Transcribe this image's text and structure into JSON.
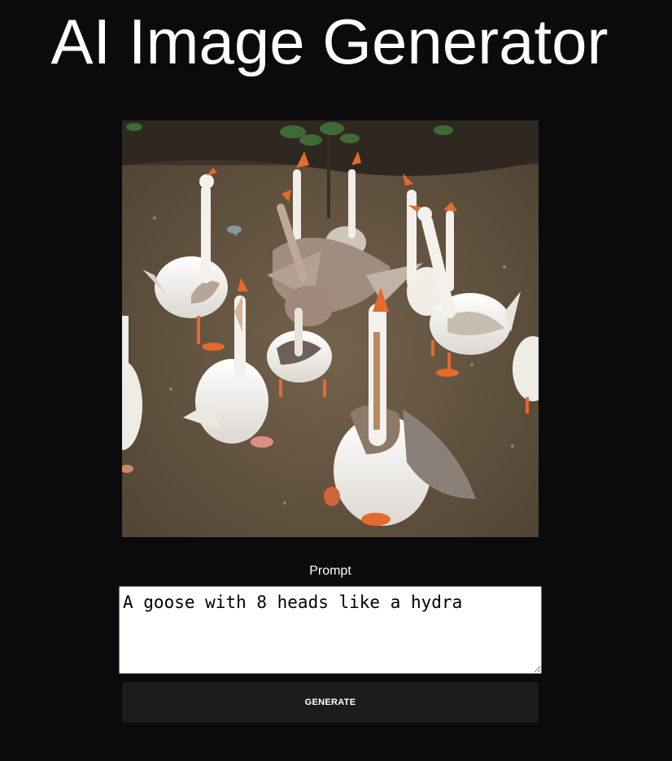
{
  "header": {
    "title": "AI Image Generator"
  },
  "generated_image": {
    "subject": "goose-flock-image"
  },
  "form": {
    "prompt_label": "Prompt",
    "prompt_value": "A goose with 8 heads like a hydra",
    "generate_label": "GENERATE"
  },
  "colors": {
    "background": "#0b0b0d",
    "button_background": "#1c1c1f",
    "text": "#ffffff"
  }
}
